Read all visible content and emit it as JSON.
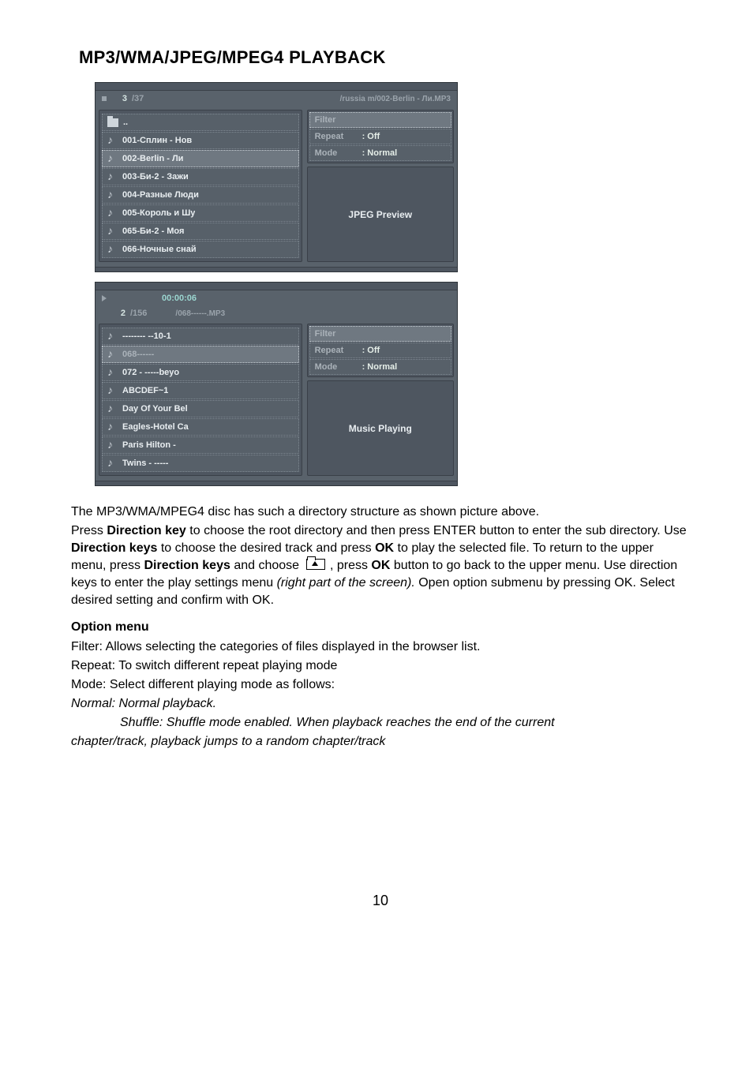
{
  "heading": "MP3/WMA/JPEG/MPEG4  PLAYBACK",
  "player1": {
    "trackno": "3",
    "total": "/37",
    "path": "/russia m/002-Berlin - Ли.MP3",
    "up": "..",
    "files": [
      "001-Сплин - Нов",
      "002-Berlin - Ли",
      "003-Би-2 - Зажи",
      "004-Разные Люди",
      "005-Король и Шу",
      "065-Би-2 - Моя",
      "066-Ночные снай"
    ],
    "options": {
      "filter_label": "Filter",
      "repeat_label": "Repeat",
      "repeat_value": ":  Off",
      "mode_label": "Mode",
      "mode_value": ":  Normal"
    },
    "preview": "JPEG Preview"
  },
  "player2": {
    "time": "00:00:06",
    "trackno": "2",
    "total": "/156",
    "path": "/068------.MP3",
    "files": [
      "-------- --10-1",
      "068------",
      "072 - -----beyo",
      "ABCDEF~1",
      "Day Of Your Bel",
      "Eagles-Hotel Ca",
      "Paris Hilton -",
      "Twins - -----"
    ],
    "options": {
      "filter_label": "Filter",
      "repeat_label": "Repeat",
      "repeat_value": ":  Off",
      "mode_label": "Mode",
      "mode_value": ":  Normal"
    },
    "preview": "Music Playing"
  },
  "paragraph": {
    "line1": "The MP3/WMA/MPEG4 disc has such a directory structure as shown picture above.",
    "line2a": "Press ",
    "line2b": "Direction key",
    "line2c": " to choose the root directory and then press ENTER button to enter the sub directory. Use ",
    "line2d": "Direction keys",
    "line2e": " to choose the desired track and press ",
    "line2f": "OK",
    "line2g": " to play the selected file. To return to the upper menu, press ",
    "line2h": "Direction keys",
    "line2i": " and choose ",
    "line2j": " , press ",
    "line2k": "OK",
    "line2l": " button to go back to the upper menu. Use direction keys to enter the play settings menu ",
    "line2m": "(right part of the screen).",
    "line2n": " Open option submenu by pressing OK. Select desired setting and confirm with OK."
  },
  "option_menu": {
    "heading": "Option menu",
    "filter": "Filter: Allows selecting the categories of files displayed in the browser list.",
    "repeat": "Repeat: To switch different repeat playing mode",
    "mode": "Mode: Select different playing mode as follows:",
    "normal": "Normal:  Normal playback.",
    "shuffle1": "Shuffle: Shuffle mode enabled. When playback reaches the end of the current",
    "shuffle2": "chapter/track, playback jumps to a random chapter/track"
  },
  "page_number": "10"
}
